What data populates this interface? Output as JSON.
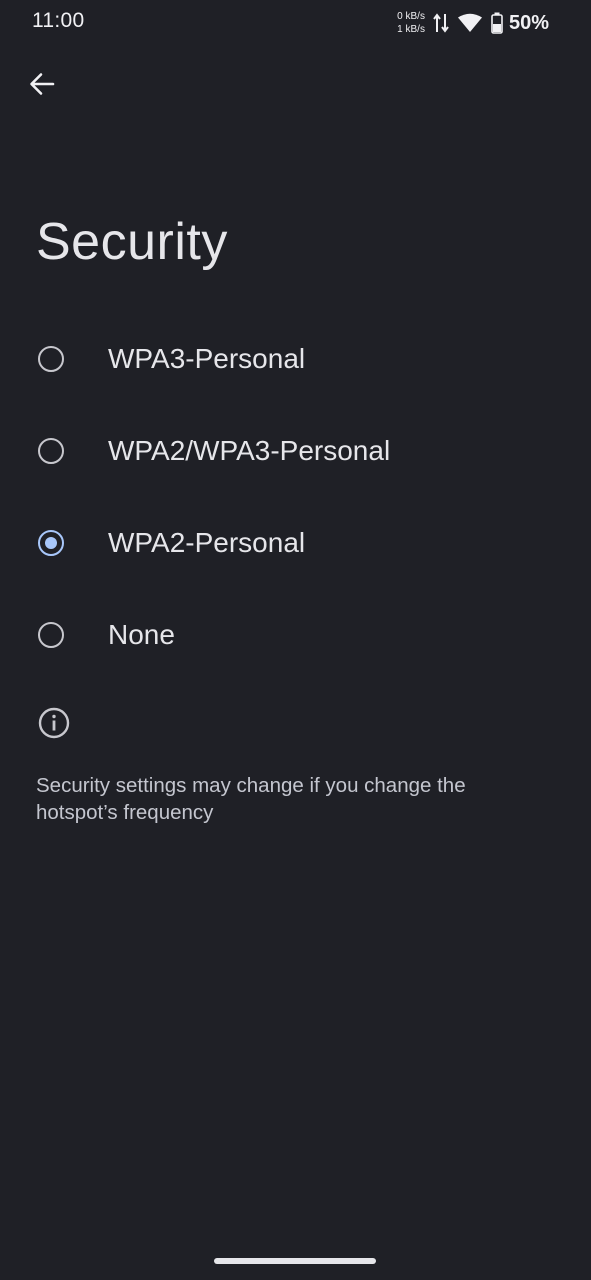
{
  "status_bar": {
    "time": "11:00",
    "upload_speed": "0 kB/s",
    "download_speed": "1 kB/s",
    "battery_percent": "50%",
    "icons": [
      "data-transfer-icon",
      "wifi-icon",
      "battery-icon"
    ]
  },
  "header": {
    "back_icon": "arrow-back-icon",
    "title": "Security"
  },
  "options": [
    {
      "label": "WPA3-Personal",
      "selected": false
    },
    {
      "label": "WPA2/WPA3-Personal",
      "selected": false
    },
    {
      "label": "WPA2-Personal",
      "selected": true
    },
    {
      "label": "None",
      "selected": false
    }
  ],
  "info": {
    "icon": "info-icon",
    "text": "Security settings may change if you change the hotspot’s frequency"
  },
  "colors": {
    "background": "#1f2026",
    "accent": "#a8c7fa",
    "text_primary": "#e6e6ea",
    "text_secondary": "#c4c6cf"
  }
}
